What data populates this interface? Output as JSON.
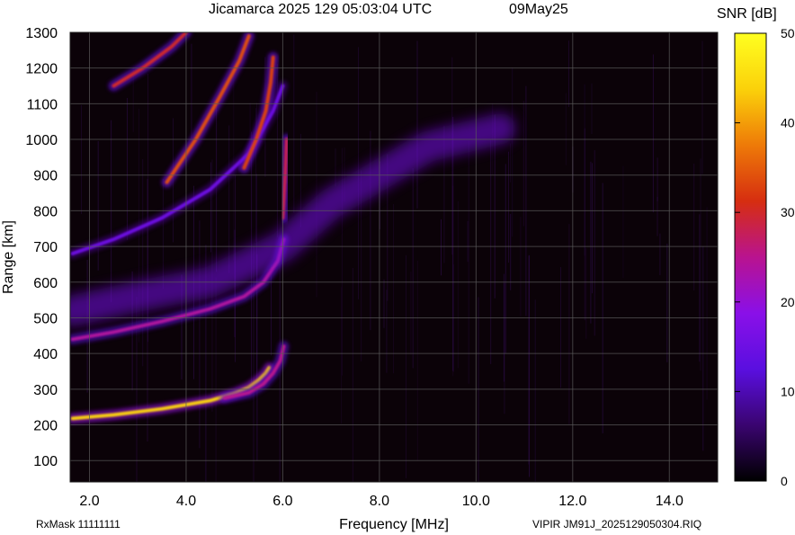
{
  "header": {
    "title": "Jicamarca 2025 129 05:03:04 UTC",
    "date": "09May25"
  },
  "footer": {
    "rx_mask": "RxMask 11111111",
    "file_name": "VIPIR  JM91J_2025129050304.RIQ"
  },
  "colors": {
    "background": "#0b0208",
    "grid": "#5a5a5a",
    "scale_stops": [
      "#000000",
      "#3a0470",
      "#5a0fe0",
      "#8a10e8",
      "#b9138f",
      "#d62e10",
      "#ee7a08",
      "#fbd10a",
      "#ffff20"
    ]
  },
  "chart_data": {
    "type": "heatmap",
    "title": "Jicamarca 2025 129 05:03:04 UTC",
    "xlabel": "Frequency [MHz]",
    "ylabel": "Range [km]",
    "xlim": [
      1.6,
      15.0
    ],
    "ylim": [
      40,
      1300
    ],
    "x_ticks": [
      {
        "value": 2.0,
        "label": "2.0"
      },
      {
        "value": 4.0,
        "label": "4.0"
      },
      {
        "value": 6.0,
        "label": "6.0"
      },
      {
        "value": 8.0,
        "label": "8.0"
      },
      {
        "value": 10.0,
        "label": "10.0"
      },
      {
        "value": 12.0,
        "label": "12.0"
      },
      {
        "value": 14.0,
        "label": "14.0"
      }
    ],
    "y_ticks": [
      {
        "value": 100,
        "label": "100"
      },
      {
        "value": 200,
        "label": "200"
      },
      {
        "value": 300,
        "label": "300"
      },
      {
        "value": 400,
        "label": "400"
      },
      {
        "value": 500,
        "label": "500"
      },
      {
        "value": 600,
        "label": "600"
      },
      {
        "value": 700,
        "label": "700"
      },
      {
        "value": 800,
        "label": "800"
      },
      {
        "value": 900,
        "label": "900"
      },
      {
        "value": 1000,
        "label": "1000"
      },
      {
        "value": 1100,
        "label": "1100"
      },
      {
        "value": 1200,
        "label": "1200"
      },
      {
        "value": 1300,
        "label": "1300"
      }
    ],
    "grid": true,
    "colorbar": {
      "label": "SNR [dB]",
      "range": [
        0,
        50
      ],
      "ticks": [
        {
          "value": 0,
          "label": "0"
        },
        {
          "value": 10,
          "label": "10"
        },
        {
          "value": 20,
          "label": "20"
        },
        {
          "value": 30,
          "label": "30"
        },
        {
          "value": 40,
          "label": "40"
        },
        {
          "value": 50,
          "label": "50"
        }
      ]
    },
    "traces": [
      {
        "id": "o-trace-1",
        "snr_db": 44,
        "points": [
          [
            1.65,
            218
          ],
          [
            2.5,
            228
          ],
          [
            3.5,
            245
          ],
          [
            4.5,
            268
          ],
          [
            5.0,
            288
          ],
          [
            5.3,
            305
          ],
          [
            5.5,
            325
          ],
          [
            5.65,
            345
          ],
          [
            5.72,
            360
          ]
        ]
      },
      {
        "id": "x-trace-1",
        "snr_db": 25,
        "points": [
          [
            4.8,
            275
          ],
          [
            5.3,
            290
          ],
          [
            5.6,
            315
          ],
          [
            5.8,
            345
          ],
          [
            5.95,
            380
          ],
          [
            6.02,
            420
          ]
        ]
      },
      {
        "id": "o-trace-2",
        "snr_db": 24,
        "points": [
          [
            1.65,
            440
          ],
          [
            2.5,
            460
          ],
          [
            3.5,
            490
          ],
          [
            4.5,
            525
          ],
          [
            5.2,
            560
          ],
          [
            5.6,
            600
          ],
          [
            5.9,
            660
          ],
          [
            6.02,
            720
          ]
        ]
      },
      {
        "id": "mixed-cloud",
        "snr_db": 16,
        "points": [
          [
            1.65,
            520
          ],
          [
            3.0,
            560
          ],
          [
            4.5,
            600
          ],
          [
            6.0,
            700
          ],
          [
            7.0,
            820
          ],
          [
            8.0,
            900
          ],
          [
            9.0,
            980
          ],
          [
            10.5,
            1030
          ]
        ]
      },
      {
        "id": "o-trace-3",
        "snr_db": 15,
        "points": [
          [
            1.65,
            680
          ],
          [
            2.5,
            720
          ],
          [
            3.5,
            780
          ],
          [
            4.5,
            860
          ],
          [
            5.3,
            960
          ],
          [
            5.8,
            1080
          ],
          [
            6.0,
            1150
          ]
        ]
      },
      {
        "id": "o-trace-4",
        "snr_db": 34,
        "points": [
          [
            3.6,
            880
          ],
          [
            4.2,
            1000
          ],
          [
            4.7,
            1120
          ],
          [
            5.1,
            1220
          ],
          [
            5.3,
            1290
          ]
        ]
      },
      {
        "id": "x-trace-2",
        "snr_db": 33,
        "points": [
          [
            5.2,
            920
          ],
          [
            5.45,
            1000
          ],
          [
            5.65,
            1080
          ],
          [
            5.75,
            1160
          ],
          [
            5.8,
            1230
          ]
        ]
      },
      {
        "id": "o-trace-5",
        "snr_db": 30,
        "points": [
          [
            2.5,
            1150
          ],
          [
            3.1,
            1200
          ],
          [
            3.7,
            1260
          ],
          [
            4.0,
            1300
          ]
        ]
      },
      {
        "id": "spread-near-6mhz",
        "snr_db": 28,
        "points": [
          [
            6.0,
            780
          ],
          [
            6.05,
            900
          ],
          [
            6.08,
            1000
          ]
        ]
      }
    ]
  }
}
